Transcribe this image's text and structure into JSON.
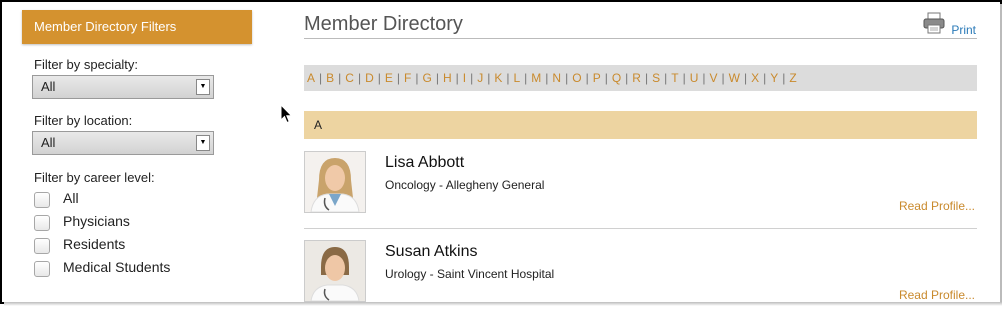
{
  "sidebar": {
    "header": "Member Directory Filters",
    "specialty": {
      "label": "Filter by specialty:",
      "value": "All"
    },
    "location": {
      "label": "Filter by location:",
      "value": "All"
    },
    "career": {
      "label": "Filter by career level:",
      "options": [
        {
          "label": "All",
          "checked": false
        },
        {
          "label": "Physicians",
          "checked": false
        },
        {
          "label": "Residents",
          "checked": false
        },
        {
          "label": "Medical Students",
          "checked": false
        }
      ]
    }
  },
  "main": {
    "title": "Member Directory",
    "print_label": "Print",
    "letters": [
      "A",
      "B",
      "C",
      "D",
      "E",
      "F",
      "G",
      "H",
      "I",
      "J",
      "K",
      "L",
      "M",
      "N",
      "O",
      "P",
      "Q",
      "R",
      "S",
      "T",
      "U",
      "V",
      "W",
      "X",
      "Y",
      "Z"
    ],
    "section_letter": "A",
    "members": [
      {
        "name": "Lisa Abbott",
        "detail": "Oncology - Allegheny General",
        "link": "Read Profile..."
      },
      {
        "name": "Susan Atkins",
        "detail": "Urology - Saint Vincent Hospital",
        "link": "Read Profile..."
      }
    ]
  },
  "colors": {
    "accent": "#d4922f",
    "link": "#c98a2d",
    "section_band": "#edd4a1",
    "print_link": "#2a7ab8"
  },
  "icons": [
    "chevron-down-icon",
    "printer-icon",
    "mouse-cursor-icon",
    "avatar"
  ]
}
